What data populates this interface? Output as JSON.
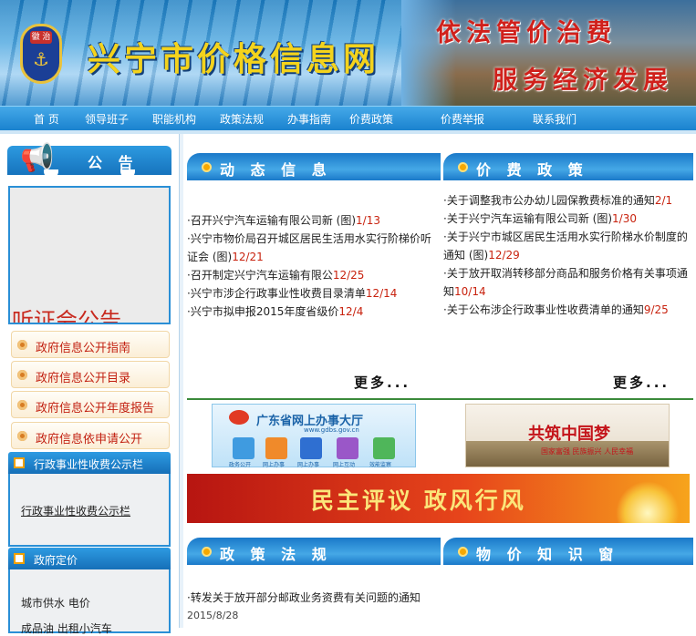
{
  "header": {
    "badge_text": "徽 治",
    "site_title": "兴宁市价格信息网",
    "slogan_line1": "依法管价治费",
    "slogan_line2": "服务经济发展"
  },
  "nav": {
    "items": [
      "首 页",
      "领导班子",
      "职能机构",
      "政策法规",
      "办事指南",
      "价费政策",
      "价费举报",
      "联系我们"
    ]
  },
  "sidebar": {
    "notice_title": "公 告",
    "notice_text": "听证会公告",
    "links": [
      "政府信息公开指南",
      "政府信息公开目录",
      "政府信息公开年度报告",
      "政府信息依申请公开"
    ],
    "fee_section_title": "行政事业性收费公示栏",
    "fee_section_link": "行政事业性收费公示栏",
    "pricing_section_title": "政府定价",
    "pricing_items": [
      "城市供水  电价",
      "成品油  出租小汽车"
    ]
  },
  "dynamic": {
    "title": "动 态 信 息",
    "items": [
      {
        "text": "召开兴宁汽车运输有限公司新 (图)",
        "date": "1/13"
      },
      {
        "text": "兴宁市物价局召开城区居民生活用水实行阶梯价听证会 (图)",
        "date": "12/21"
      },
      {
        "text": "召开制定兴宁汽车运输有限公",
        "date": "12/25"
      },
      {
        "text": "兴宁市涉企行政事业性收费目录清单",
        "date": "12/14"
      },
      {
        "text": "兴宁市拟申报2015年度省级价",
        "date": "12/4"
      }
    ],
    "more": "更多..."
  },
  "policy": {
    "title": "价 费 政 策",
    "items": [
      {
        "text": "关于调整我市公办幼儿园保教费标准的通知",
        "date": "2/1"
      },
      {
        "text": "关于兴宁汽车运输有限公司新 (图)",
        "date": "1/30"
      },
      {
        "text": "关于兴宁市城区居民生活用水实行阶梯水价制度的通知 (图)",
        "date": "12/29"
      },
      {
        "text": "关于放开取消转移部分商品和服务价格有关事项通知",
        "date": "10/14"
      },
      {
        "text": "关于公布涉企行政事业性收费清单的通知",
        "date": "9/25"
      }
    ],
    "more": "更多..."
  },
  "ads": {
    "gd_title": "广东省网上办事大厅",
    "gd_url": "www.gdbs.gov.cn",
    "gd_tiles": [
      "政务公开",
      "网上办事",
      "网上办事",
      "网上互动",
      "效能监察"
    ],
    "dream_title": "共筑中国梦",
    "dream_sub": "国家富强  民族振兴  人民幸福",
    "banner_text": "民主评议 政风行风"
  },
  "laws": {
    "title": "政 策 法 规",
    "items": [
      {
        "text": "转发关于放开部分邮政业务资费有关问题的通知",
        "date": "2015/8/28"
      }
    ]
  },
  "knowledge": {
    "title": "物 价 知 识 窗"
  },
  "colors": {
    "nav_blue": "#1a82cf",
    "date_red": "#c8220e",
    "title_yellow": "#f4d31c",
    "slogan_red": "#d0201b"
  }
}
